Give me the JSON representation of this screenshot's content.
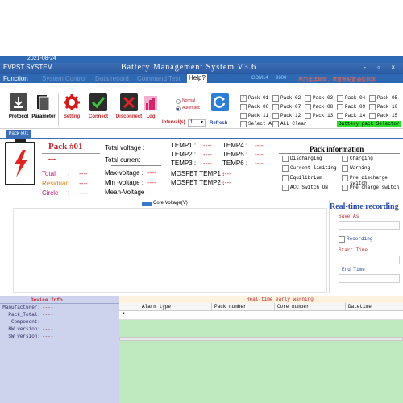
{
  "window": {
    "date": "2021-08-24",
    "app_name": "EVPST SYSTEM",
    "title": "Battery Management System   V3.6",
    "controls": "- ▫ ×"
  },
  "menu": {
    "function": "Function",
    "system_control": "System Control",
    "data_record": "Data record",
    "command_test": "Command Test",
    "help": "Help?",
    "port": "COM14",
    "baud": "9600",
    "notice": "串口连接异常，请重新配置通信参数..."
  },
  "toolbar": {
    "protocol": "Protocol",
    "parameter": "Parameter",
    "setting": "Setting",
    "connect": "Connect",
    "disconnect": "Disconnect",
    "log": "Log",
    "interval_label": "Interval(s)",
    "interval_value": "1",
    "refresh": "Refresh",
    "mode_normal": "Normal",
    "mode_automatic": "Automatic"
  },
  "pack_selector": {
    "packs": [
      "Pack 01",
      "Pack 02",
      "Pack 03",
      "Pack 04",
      "Pack 05",
      "Pack 06",
      "Pack 07",
      "Pack 08",
      "Pack 09",
      "Pack 10",
      "Pack 11",
      "Pack 12",
      "Pack 13",
      "Pack 14",
      "Pack 15"
    ],
    "select_all": "Select ALL",
    "all_clear": "ALL Clear",
    "badge": "Battery pack Selector"
  },
  "tab": {
    "label": "Pack #01"
  },
  "pack": {
    "title": "Pack #01",
    "status": "---",
    "total_label": "Total",
    "total_value": "----",
    "residual_label": "Residual:",
    "residual_value": "----",
    "circle_label": "Circle",
    "circle_value": "----",
    "sep": ":"
  },
  "voltages": {
    "total_voltage": "Total voltage :",
    "total_current": "Total current :",
    "max_voltage": "Max-voltage :",
    "min_voltage": "Min -voltage :",
    "mean_voltage": "Mean-Voltage :",
    "dash": "----"
  },
  "temps": {
    "temp1": "TEMP1 :",
    "temp2": "TEMP2 :",
    "temp3": "TEMP3 :",
    "temp4": "TEMP4 :",
    "temp5": "TEMP5 :",
    "temp6": "TEMP6 :",
    "mosfet1": "MOSFET TEMP1 :",
    "mosfet2": "MOSFET TEMP2 :",
    "dash": "----"
  },
  "pack_info": {
    "title": "Pack information",
    "items": [
      "Discharging",
      "Charging",
      "Current-limiting",
      "Warning",
      "Equilibrium",
      "Pre discharge switch",
      "ACC Switch ON",
      "Pre charge switch"
    ]
  },
  "chart": {
    "legend": "Core Voltage(V)",
    "legend_color": "#3a78c8"
  },
  "recording": {
    "title": "Real-time recording",
    "save_as": "Save As",
    "recording": "Recording",
    "start_time": "Start Time",
    "end_time": "End Time"
  },
  "device_info": {
    "title": "Device Info",
    "rows": [
      {
        "label": "Manufacturer:",
        "value": "----"
      },
      {
        "label": "Pack_Total:",
        "value": "----"
      },
      {
        "label": "Component:",
        "value": "----"
      },
      {
        "label": "HW version:",
        "value": "----"
      },
      {
        "label": "SW version:",
        "value": "----"
      }
    ]
  },
  "warning": {
    "title": "Real-time early warning",
    "columns": [
      "Alarm type",
      "Pack number",
      "Core number",
      "Datetime"
    ],
    "row_marker": "*"
  },
  "colors": {
    "titlebar": "#2f68b2",
    "alert_red": "#c0282c",
    "badge_green": "#2ce02c"
  }
}
